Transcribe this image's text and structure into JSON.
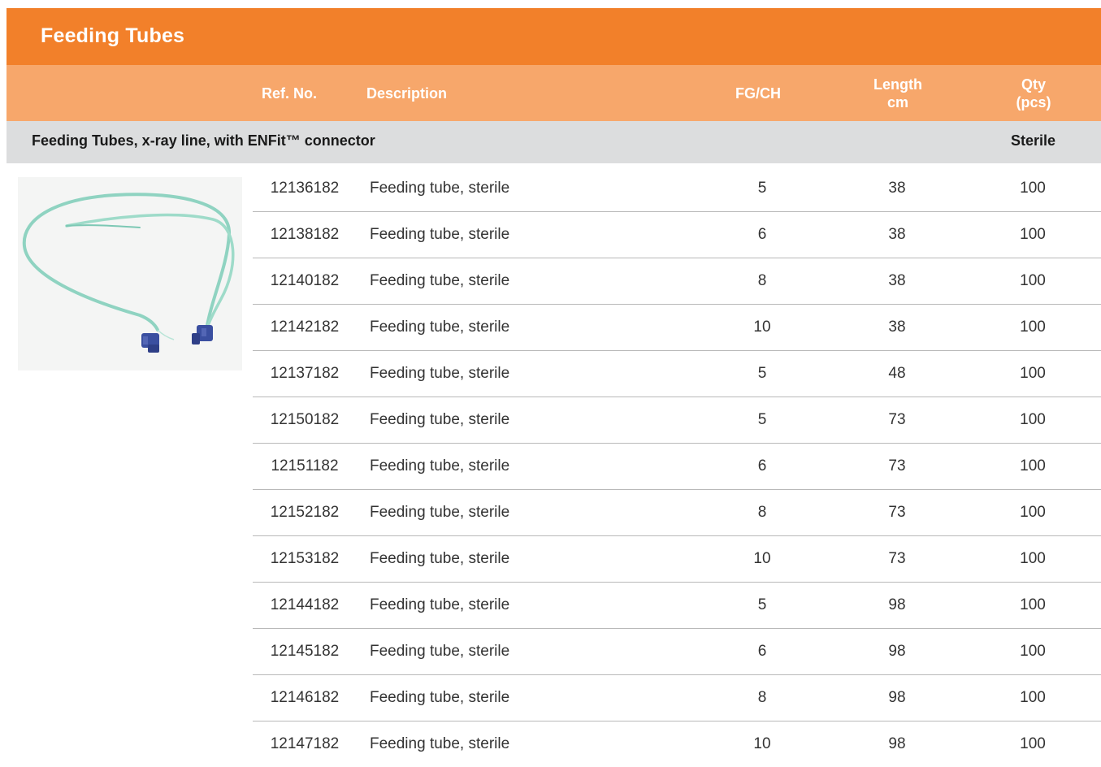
{
  "page": {
    "title": "Feeding Tubes"
  },
  "table": {
    "headers": {
      "ref": "Ref. No.",
      "description": "Description",
      "fg": "FG/CH",
      "length_line1": "Length",
      "length_line2": "cm",
      "qty_line1": "Qty",
      "qty_line2": "(pcs)"
    },
    "section": {
      "title": "Feeding Tubes, x-ray line, with ENFit™ connector",
      "status": "Sterile"
    },
    "rows": [
      {
        "ref": "12136182",
        "description": "Feeding tube, sterile",
        "fg": "5",
        "length": "38",
        "qty": "100"
      },
      {
        "ref": "12138182",
        "description": "Feeding tube, sterile",
        "fg": "6",
        "length": "38",
        "qty": "100"
      },
      {
        "ref": "12140182",
        "description": "Feeding tube, sterile",
        "fg": "8",
        "length": "38",
        "qty": "100"
      },
      {
        "ref": "12142182",
        "description": "Feeding tube, sterile",
        "fg": "10",
        "length": "38",
        "qty": "100"
      },
      {
        "ref": "12137182",
        "description": "Feeding tube, sterile",
        "fg": "5",
        "length": "48",
        "qty": "100"
      },
      {
        "ref": "12150182",
        "description": "Feeding tube, sterile",
        "fg": "5",
        "length": "73",
        "qty": "100"
      },
      {
        "ref": "12151182",
        "description": "Feeding tube, sterile",
        "fg": "6",
        "length": "73",
        "qty": "100"
      },
      {
        "ref": "12152182",
        "description": "Feeding tube, sterile",
        "fg": "8",
        "length": "73",
        "qty": "100"
      },
      {
        "ref": "12153182",
        "description": "Feeding tube, sterile",
        "fg": "10",
        "length": "73",
        "qty": "100"
      },
      {
        "ref": "12144182",
        "description": "Feeding tube, sterile",
        "fg": "5",
        "length": "98",
        "qty": "100"
      },
      {
        "ref": "12145182",
        "description": "Feeding tube, sterile",
        "fg": "6",
        "length": "98",
        "qty": "100"
      },
      {
        "ref": "12146182",
        "description": "Feeding tube, sterile",
        "fg": "8",
        "length": "98",
        "qty": "100"
      },
      {
        "ref": "12147182",
        "description": "Feeding tube, sterile",
        "fg": "10",
        "length": "98",
        "qty": "100"
      }
    ]
  },
  "colors": {
    "title_bar": "#f2802a",
    "header_bar": "#f7a76b",
    "section_bar": "#dcddde",
    "tube": "#8fd3c1",
    "connector": "#3a4fa0"
  },
  "image": {
    "subject": "feeding-tube-product-photo"
  }
}
